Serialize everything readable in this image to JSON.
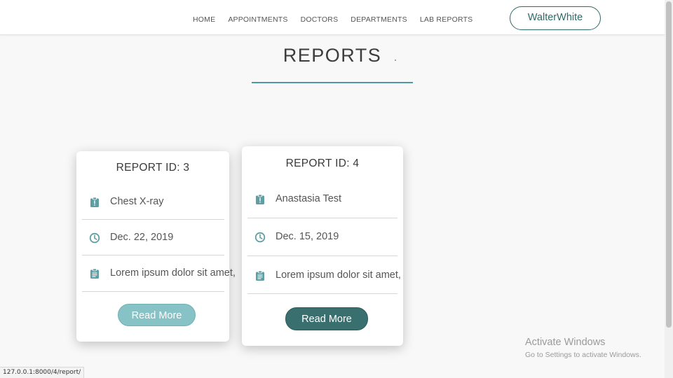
{
  "nav": {
    "items": [
      {
        "label": "HOME"
      },
      {
        "label": "APPOINTMENTS"
      },
      {
        "label": "DOCTORS"
      },
      {
        "label": "DEPARTMENTS"
      },
      {
        "label": "LAB REPORTS"
      }
    ],
    "user_button": "WalterWhite"
  },
  "page": {
    "title": "REPORTS"
  },
  "reports": [
    {
      "title": "REPORT ID: 3",
      "test_name": "Chest X-ray",
      "date": "Dec. 22, 2019",
      "description": "Lorem ipsum dolor sit amet,",
      "button": "Read More",
      "button_state": "normal"
    },
    {
      "title": "REPORT ID: 4",
      "test_name": "Anastasia Test",
      "date": "Dec. 15, 2019",
      "description": "Lorem ipsum dolor sit amet,",
      "button": "Read More",
      "button_state": "hover"
    }
  ],
  "icons": {
    "test": "alert-clipboard-icon",
    "date": "clock-icon",
    "description": "clipboard-list-icon"
  },
  "status_bar": {
    "url": "127.0.0.1:8000/4/report/"
  },
  "watermark": {
    "title": "Activate Windows",
    "subtitle": "Go to Settings to activate Windows."
  },
  "colors": {
    "accent": "#4f9aa0",
    "button_light": "#87c2c6",
    "button_dark": "#3a6f6f",
    "icon": "#5f9ea3"
  }
}
